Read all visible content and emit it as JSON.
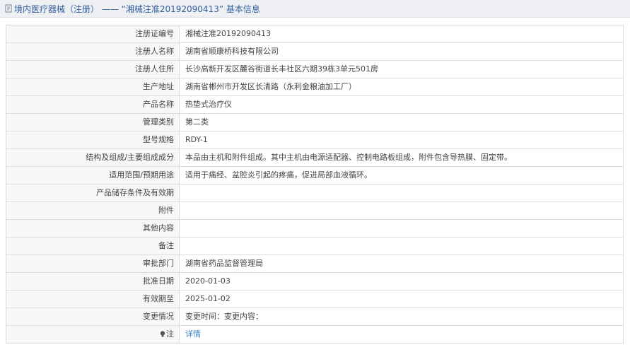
{
  "header": {
    "title": "境内医疗器械（注册） —— “湘械注准20192090413” 基本信息",
    "icon": "document-icon"
  },
  "rows": [
    {
      "key": "reg_no",
      "label": "注册证编号",
      "value": "湘械注准20192090413"
    },
    {
      "key": "registrant",
      "label": "注册人名称",
      "value": "湖南省顺康桥科技有限公司"
    },
    {
      "key": "registrant_address",
      "label": "注册人住所",
      "value": "长沙高新开发区麓谷街道长丰社区六期39栋3单元501房"
    },
    {
      "key": "production_address",
      "label": "生产地址",
      "value": "湖南省郴州市开发区长清路（永利金粮油加工厂）"
    },
    {
      "key": "product_name",
      "label": "产品名称",
      "value": "热垫式治疗仪"
    },
    {
      "key": "category",
      "label": "管理类别",
      "value": "第二类"
    },
    {
      "key": "model",
      "label": "型号规格",
      "value": "RDY-1"
    },
    {
      "key": "composition",
      "label": "结构及组成/主要组成成分",
      "value": "本品由主机和附件组成。其中主机由电源适配器、控制电路板组成，附件包含导热膜、固定带。"
    },
    {
      "key": "scope",
      "label": "适用范围/预期用途",
      "value": "适用于痛经、盆腔炎引起的疼痛，促进局部血液循环。"
    },
    {
      "key": "storage",
      "label": "产品储存条件及有效期",
      "value": ""
    },
    {
      "key": "attachment",
      "label": "附件",
      "value": ""
    },
    {
      "key": "other",
      "label": "其他内容",
      "value": ""
    },
    {
      "key": "remark",
      "label": "备注",
      "value": ""
    },
    {
      "key": "approval_dept",
      "label": "审批部门",
      "value": "湖南省药品监督管理局"
    },
    {
      "key": "approval_date",
      "label": "批准日期",
      "value": "2020-01-03"
    },
    {
      "key": "valid_until",
      "label": "有效期至",
      "value": "2025-01-02"
    },
    {
      "key": "change",
      "label": "变更情况",
      "value": "变更时间：变更内容："
    }
  ],
  "note": {
    "label": "注",
    "link_text": "详情",
    "icon": "lightbulb-icon"
  }
}
